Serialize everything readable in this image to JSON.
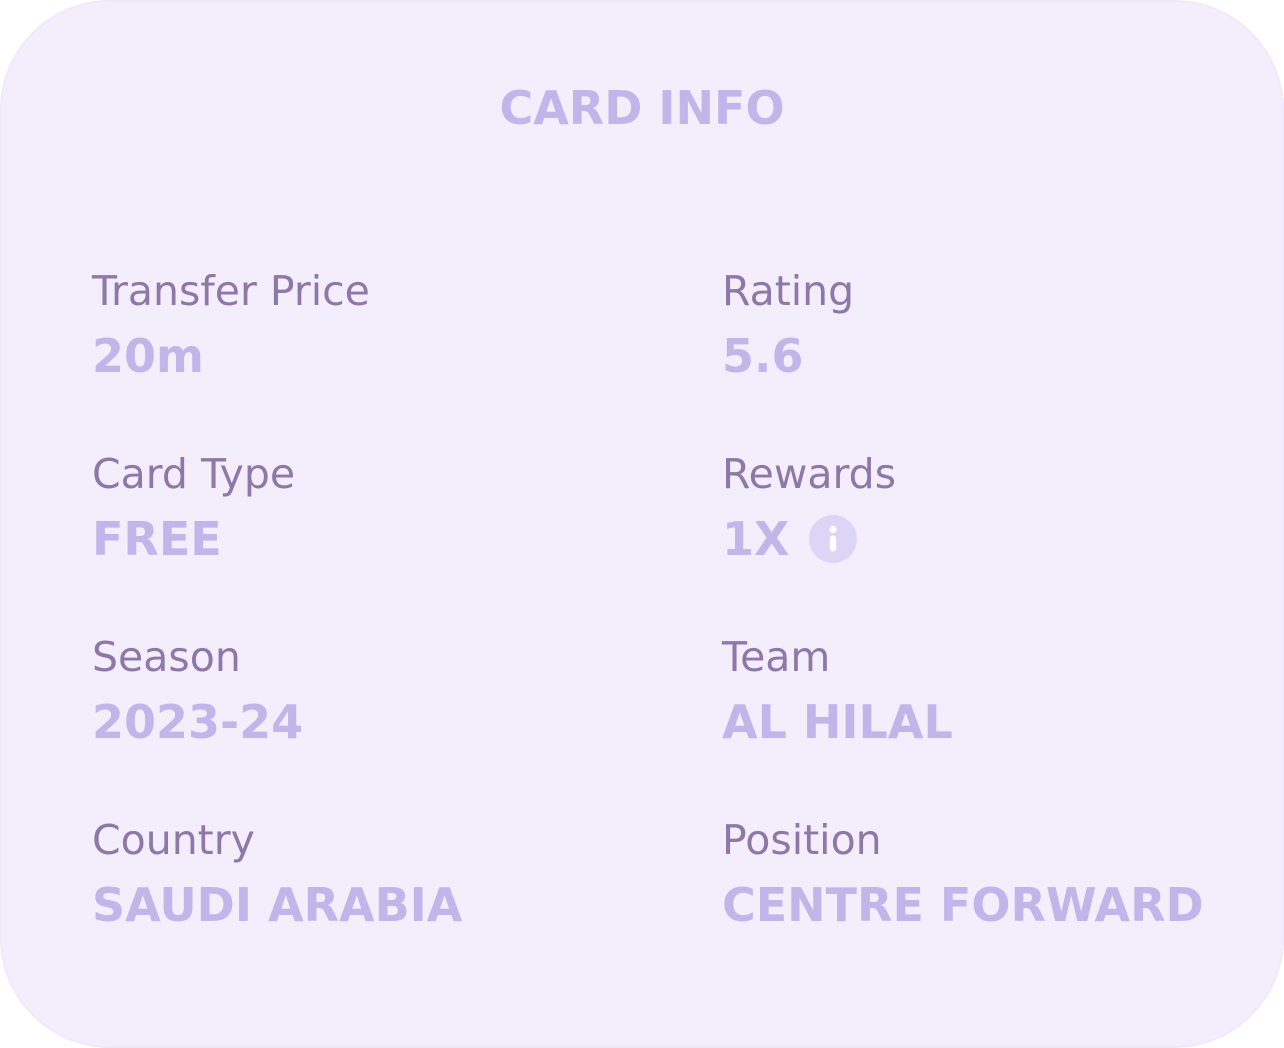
{
  "card": {
    "title": "CARD INFO"
  },
  "fields": {
    "transfer_price": {
      "label": "Transfer Price",
      "value": "20m"
    },
    "rating": {
      "label": "Rating",
      "value": "5.6"
    },
    "card_type": {
      "label": "Card Type",
      "value": "FREE"
    },
    "rewards": {
      "label": "Rewards",
      "value": "1X",
      "icon": "info-icon"
    },
    "season": {
      "label": "Season",
      "value": "2023-24"
    },
    "team": {
      "label": "Team",
      "value": "AL HILAL"
    },
    "country": {
      "label": "Country",
      "value": "SAUDI ARABIA"
    },
    "position": {
      "label": "Position",
      "value": "CENTRE FORWARD"
    }
  },
  "colors": {
    "card_background": "#f4eefc",
    "label": "#8e78a8",
    "value": "#c2b5ea",
    "info_icon_bg": "#ddd5f5"
  }
}
